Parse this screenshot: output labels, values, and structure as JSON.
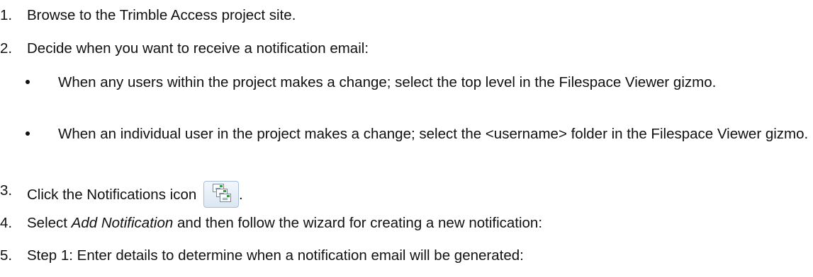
{
  "steps": [
    {
      "num": "1.",
      "text": "Browse to the Trimble Access project site."
    },
    {
      "num": "2.",
      "text": "Decide when you want to receive a notification email:"
    },
    {
      "num": "3.",
      "text_before_icon": "Click the Notifications icon",
      "text_after_icon": "."
    },
    {
      "num": "4.",
      "text_prefix": "Select ",
      "text_emphasis": "Add Notification",
      "text_suffix": " and then follow the wizard for creating a new notification:"
    },
    {
      "num": "5.",
      "text": "Step 1: Enter details to determine when a notification email will be generated:"
    }
  ],
  "bullets": [
    {
      "text": "When any users within the project makes a change; select the top level in the Filespace Viewer gizmo."
    },
    {
      "text": "When an individual user in the project makes a change; select the <username> folder in the Filespace Viewer gizmo."
    }
  ],
  "icons": {
    "notifications": "notifications-icon"
  }
}
